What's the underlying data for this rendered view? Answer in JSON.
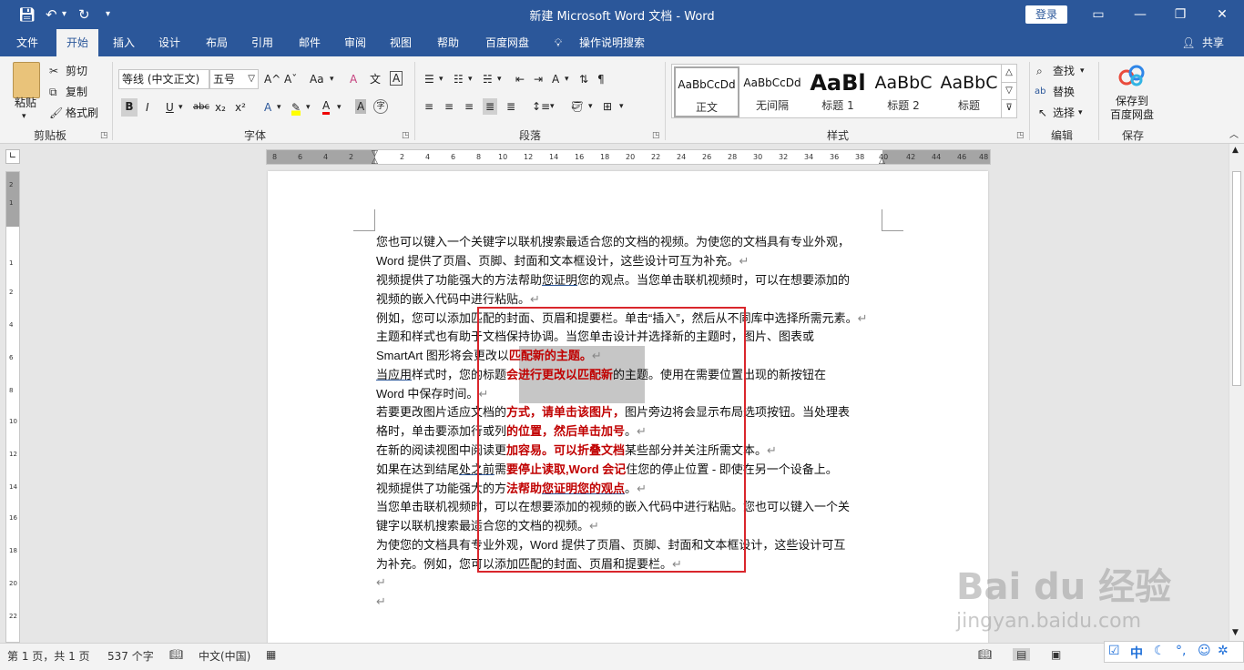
{
  "titlebar": {
    "title": "新建 Microsoft Word 文档  -  Word",
    "login": "登录",
    "save_icon": "save-icon",
    "undo_icon": "undo-icon",
    "redo_icon": "redo-icon"
  },
  "menu": {
    "tabs": [
      "文件",
      "开始",
      "插入",
      "设计",
      "布局",
      "引用",
      "邮件",
      "审阅",
      "视图",
      "帮助",
      "百度网盘"
    ],
    "search": "操作说明搜索",
    "share": "共享"
  },
  "ribbon": {
    "clipboard": {
      "paste": "粘贴",
      "cut": "剪切",
      "copy": "复制",
      "format_painter": "格式刷",
      "label": "剪贴板"
    },
    "font": {
      "name": "等线 (中文正文)",
      "size": "五号",
      "label": "字体",
      "bold": "B",
      "italic": "I",
      "underline": "U",
      "strike": "abc",
      "sub": "x₂",
      "sup": "x²",
      "grow": "A^",
      "shrink": "Aˇ",
      "case": "Aa",
      "clear": "A",
      "wen": "文",
      "frame": "A",
      "color_a": "A",
      "shade_a": "A",
      "enc": "字"
    },
    "paragraph": {
      "label": "段落"
    },
    "styles": {
      "label": "样式",
      "items": [
        {
          "preview": "AaBbCcDd",
          "name": "正文"
        },
        {
          "preview": "AaBbCcDd",
          "name": "无间隔"
        },
        {
          "preview": "AaBl",
          "name": "标题 1"
        },
        {
          "preview": "AaBbC",
          "name": "标题 2"
        },
        {
          "preview": "AaBbC",
          "name": "标题"
        }
      ]
    },
    "editing": {
      "find": "查找",
      "replace": "替换",
      "select": "选择",
      "label": "编辑"
    },
    "save": {
      "button": "保存到\n百度网盘",
      "line1": "保存到",
      "line2": "百度网盘",
      "label": "保存"
    }
  },
  "ruler": {
    "left_ticks": [
      "8",
      "6",
      "4",
      "2"
    ],
    "ticks": [
      "2",
      "4",
      "6",
      "8",
      "10",
      "12",
      "14",
      "16",
      "18",
      "20",
      "22",
      "24",
      "26",
      "28",
      "30",
      "32",
      "34",
      "36",
      "38",
      "40",
      "42",
      "44",
      "46",
      "48"
    ],
    "vticks": [
      "2",
      "1",
      "1",
      "2",
      "4",
      "6",
      "8",
      "10",
      "12",
      "14",
      "16",
      "18",
      "20",
      "22"
    ]
  },
  "document": {
    "lines": [
      [
        "您也可以键入一个关键字以联机搜索最适合您的文档的视频。为使您的文档具有专业外观，"
      ],
      [
        "Word  提供了页眉、页脚、封面和文本框设计，这些设计可互为补充。",
        "↵"
      ],
      [
        "视频提供了功能强大的方法帮助",
        "您证明",
        "您的观点。当您单击联机视频时，可以在想要添加的"
      ],
      [
        "视频的嵌入代码中进行粘贴。",
        "↵"
      ],
      [
        "例如，您可以添加匹配的封面、页眉和提要栏。单击“插入”，然后从不同库中选择所需元素。",
        "↵"
      ],
      [
        "主题和样式也有助于文档保持协调。当您单击设计并选择新的主题时，图片、图表或"
      ],
      [
        "SmartArt  图形将会更改以",
        "匹配新的主题。",
        "↵"
      ],
      [
        "当应用",
        "样式时，您的标题",
        "会进行更改以匹配新",
        "的主题。使用在需要位置出现的新按钮在"
      ],
      [
        "Word  中保存时间。",
        "↵"
      ],
      [
        "若要更改图片适应文档的",
        "方式，请单击该图片，",
        "图片旁边将会显示布局选项按钮。当处理表"
      ],
      [
        "格时，单击要添加行或列",
        "的位置，然后单击加号",
        "。",
        "↵"
      ],
      [
        "在新的阅读视图中阅读更",
        "加容易。可以折叠文档",
        "某些部分并关注所需文本。",
        "↵"
      ],
      [
        "如果在达到结尾",
        "处之前",
        "需",
        "要停止读取,Word  会记",
        "住您的停止位置  -  即使在另一个设备上。"
      ],
      [
        "视频提供了功能强大的方",
        "法帮助",
        "您证明您的观点",
        "。",
        "↵"
      ],
      [
        "当您单击联机视频时，可以在想要添加的视频的嵌入代码中进行粘贴。您也可以键入一个关"
      ],
      [
        "键字以联机搜索最适合您的文档的视频。",
        "↵"
      ],
      [
        "为使您的文档具有专业外观，Word  提供了页眉、页脚、封面和文本框设计，这些设计可互"
      ],
      [
        "为补充。例如，您可以添加匹配的封面、页眉和提要栏。",
        "↵"
      ],
      [
        "↵"
      ],
      [
        "↵"
      ]
    ]
  },
  "status": {
    "page": "第 1 页，共 1 页",
    "words": "537 个字",
    "lang": "中文(中国)",
    "ime": "中"
  },
  "watermark": {
    "main": "Bai du 经验",
    "sub": "jingyan.baidu.com"
  }
}
